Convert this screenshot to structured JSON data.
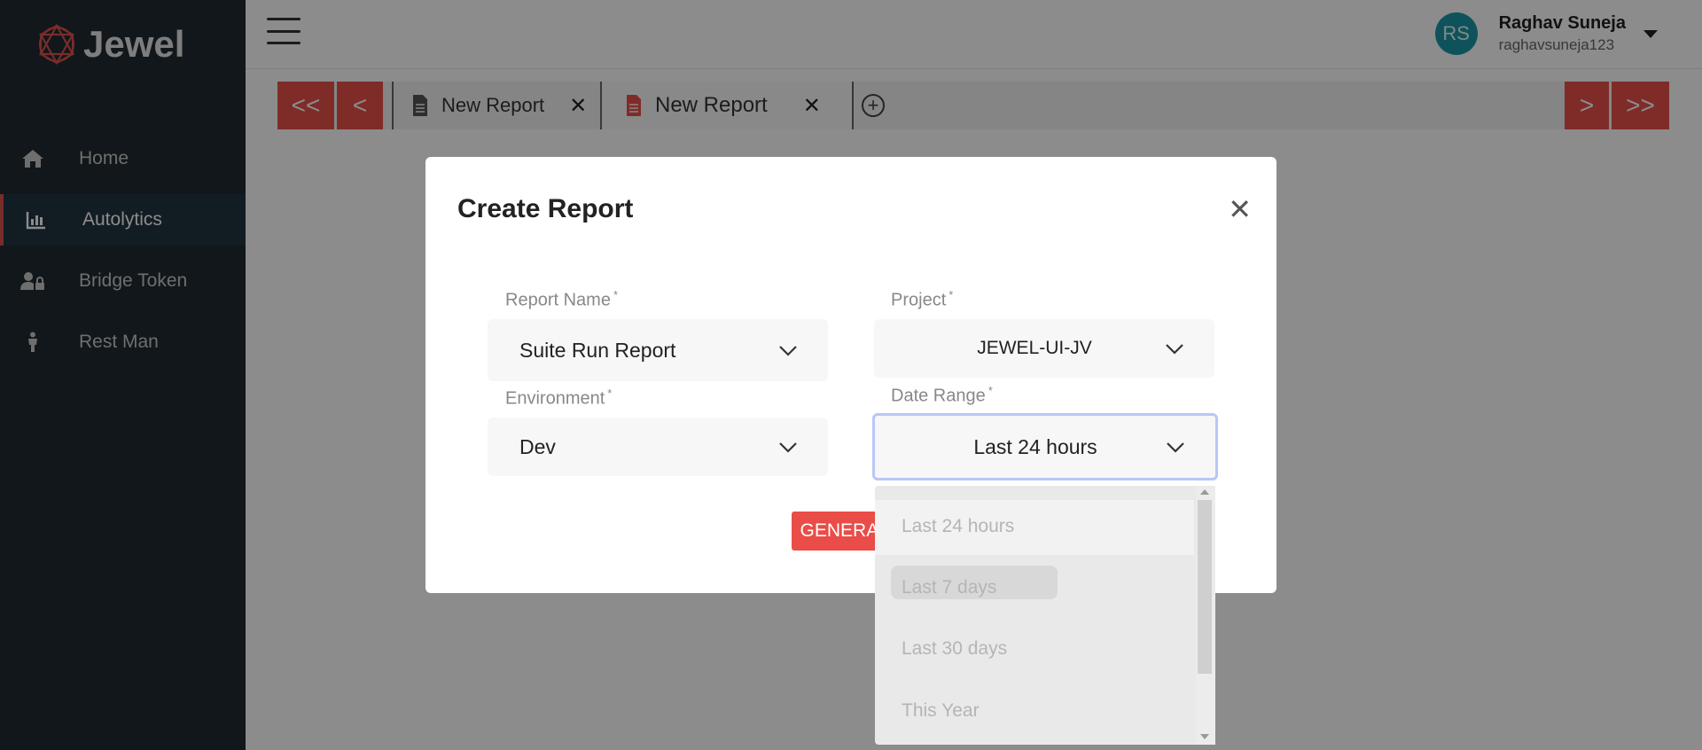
{
  "app": {
    "name": "Jewel"
  },
  "sidebar": {
    "items": [
      {
        "label": "Home",
        "icon": "home-icon"
      },
      {
        "label": "Autolytics",
        "icon": "bar-chart-icon"
      },
      {
        "label": "Bridge Token",
        "icon": "user-lock-icon"
      },
      {
        "label": "Rest Man",
        "icon": "person-icon"
      }
    ]
  },
  "header": {
    "user": {
      "initials": "RS",
      "name": "Raghav Suneja",
      "handle": "raghavsuneja123"
    }
  },
  "tabs": [
    {
      "label": "New Report"
    },
    {
      "label": "New Report"
    }
  ],
  "modal": {
    "title": "Create Report",
    "fields": {
      "report_name": {
        "label": "Report Name",
        "value": "Suite Run Report"
      },
      "project": {
        "label": "Project",
        "value": "JEWEL-UI-JV"
      },
      "environment": {
        "label": "Environment",
        "value": "Dev"
      },
      "date_range": {
        "label": "Date Range",
        "value": "Last 24 hours"
      }
    },
    "required_mark": "*",
    "generate_label": "GENERATE"
  },
  "date_range_options": [
    "Last 24 hours",
    "Last 7 days",
    "Last 30 days",
    "This Year"
  ],
  "colors": {
    "sidebar_bg": "#1f2a30",
    "accent": "#e8504b",
    "avatar": "#1a98a8",
    "focus_border": "#b9c6f7"
  }
}
